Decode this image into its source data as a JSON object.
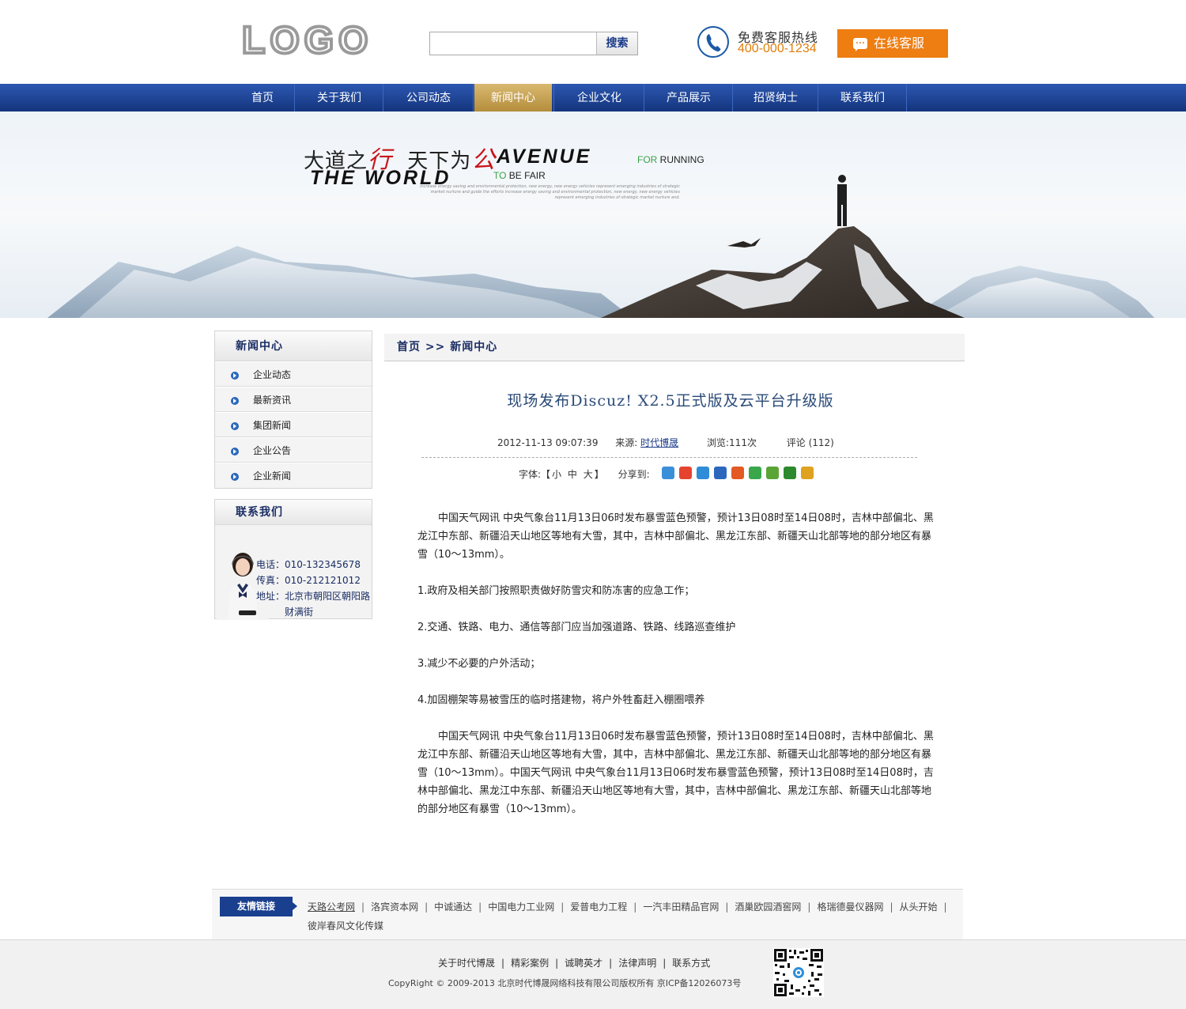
{
  "header": {
    "logo": "LOGO",
    "search": {
      "value": "",
      "placeholder": "",
      "button": "搜索"
    },
    "hotline": {
      "title": "免费客服热线",
      "number": "400-000-1234",
      "icon": "phone-icon"
    },
    "online_service": {
      "label": "在线客服",
      "icon": "chat-bubble-icon"
    }
  },
  "nav": {
    "items": [
      {
        "label": "首页"
      },
      {
        "label": "关于我们"
      },
      {
        "label": "公司动态"
      },
      {
        "label": "新闻中心"
      },
      {
        "label": "企业文化"
      },
      {
        "label": "产品展示"
      },
      {
        "label": "招贤纳士"
      },
      {
        "label": "联系我们"
      }
    ],
    "active": "新闻中心"
  },
  "banner": {
    "cn_text_1": "大道之",
    "cn_red_1": "行",
    "cn_text_2": "天下为",
    "cn_red_2": "公",
    "avenue": "AVENUE",
    "for": "FOR",
    "running": " RUNNING",
    "world": "THE WORLD",
    "to": "TO",
    "be_fair": " BE FAIR",
    "small_text": "increase energy saving and environmental protection, new energy, new energy vehicles represent emerging industries of strategic market nurture and guide the efforts increase energy saving and environmental protection, new energy, new energy vehicles represent emerging industries of strategic market nurture and."
  },
  "sidebar": {
    "news": {
      "title": "新闻中心",
      "items": [
        "企业动态",
        "最新资讯",
        "集团新闻",
        "企业公告",
        "企业新闻"
      ]
    },
    "contact": {
      "title": "联系我们",
      "phone": "电话：010-132345678",
      "fax": "传真：010-212121012",
      "address_1": "地址：北京市朝阳区朝阳路",
      "address_2": "财满街"
    }
  },
  "breadcrumb": {
    "home": "首页",
    "sep": " >> ",
    "current": "新闻中心"
  },
  "article": {
    "title": "现场发布Discuz! X2.5正式版及云平台升级版",
    "date": "2012-11-13 09:07:39",
    "source_label": "来源:",
    "source": "时代博晟",
    "views": "浏览:111次",
    "comments": "评论 (112)",
    "font_label": "字体:【",
    "font_small": "小",
    "font_medium": "中",
    "font_large": "大",
    "font_end": "】",
    "share_label": "分享到:",
    "share_icons": [
      {
        "name": "qzone-icon",
        "color": "#3b8fd9"
      },
      {
        "name": "weibo-icon",
        "color": "#e5432f"
      },
      {
        "name": "tencent-weibo-icon",
        "color": "#2f8cd6"
      },
      {
        "name": "renren-icon",
        "color": "#2c67bd"
      },
      {
        "name": "kaixin-icon",
        "color": "#e35a22"
      },
      {
        "name": "clover-icon",
        "color": "#3aa74b"
      },
      {
        "name": "pengyou-icon",
        "color": "#5aa437"
      },
      {
        "name": "douban-icon",
        "color": "#2c8a2c"
      },
      {
        "name": "tianya-icon",
        "color": "#e0a11e"
      }
    ],
    "paragraphs": [
      "　　中国天气网讯  中央气象台11月13日06时发布暴雪蓝色预警，预计13日08时至14日08时，吉林中部偏北、黑龙江中东部、新疆沿天山地区等地有大雪，其中，吉林中部偏北、黑龙江东部、新疆天山北部等地的部分地区有暴雪（10～13mm）。",
      "1.政府及相关部门按照职责做好防雪灾和防冻害的应急工作；",
      "2.交通、铁路、电力、通信等部门应当加强道路、铁路、线路巡查维护",
      "3.减少不必要的户外活动；",
      "4.加固棚架等易被雪压的临时搭建物，将户外牲畜赶入棚圈喂养",
      "　　中国天气网讯  中央气象台11月13日06时发布暴雪蓝色预警，预计13日08时至14日08时，吉林中部偏北、黑龙江中东部、新疆沿天山地区等地有大雪，其中，吉林中部偏北、黑龙江东部、新疆天山北部等地的部分地区有暴雪（10～13mm）。中国天气网讯  中央气象台11月13日06时发布暴雪蓝色预警，预计13日08时至14日08时，吉林中部偏北、黑龙江中东部、新疆沿天山地区等地有大雪，其中，吉林中部偏北、黑龙江东部、新疆天山北部等地的部分地区有暴雪（10～13mm）。"
    ]
  },
  "friend_links": {
    "label": "友情链接",
    "items": [
      "天路公考网",
      "洛宾资本网",
      "中诚通达",
      "中国电力工业网",
      "爱普电力工程",
      "一汽丰田精品官网",
      "酒巢欧园酒窖网",
      "格瑞德曼仪器网",
      "从头开始",
      "彼岸春风文化传媒"
    ]
  },
  "footer": {
    "nav": [
      "关于时代博晟",
      "精彩案例",
      "诚聘英才",
      "法律声明",
      "联系方式"
    ],
    "copyright": "CopyRight © 2009-2013  北京时代博晟网络科技有限公司版权所有  京ICP备12026073号"
  }
}
